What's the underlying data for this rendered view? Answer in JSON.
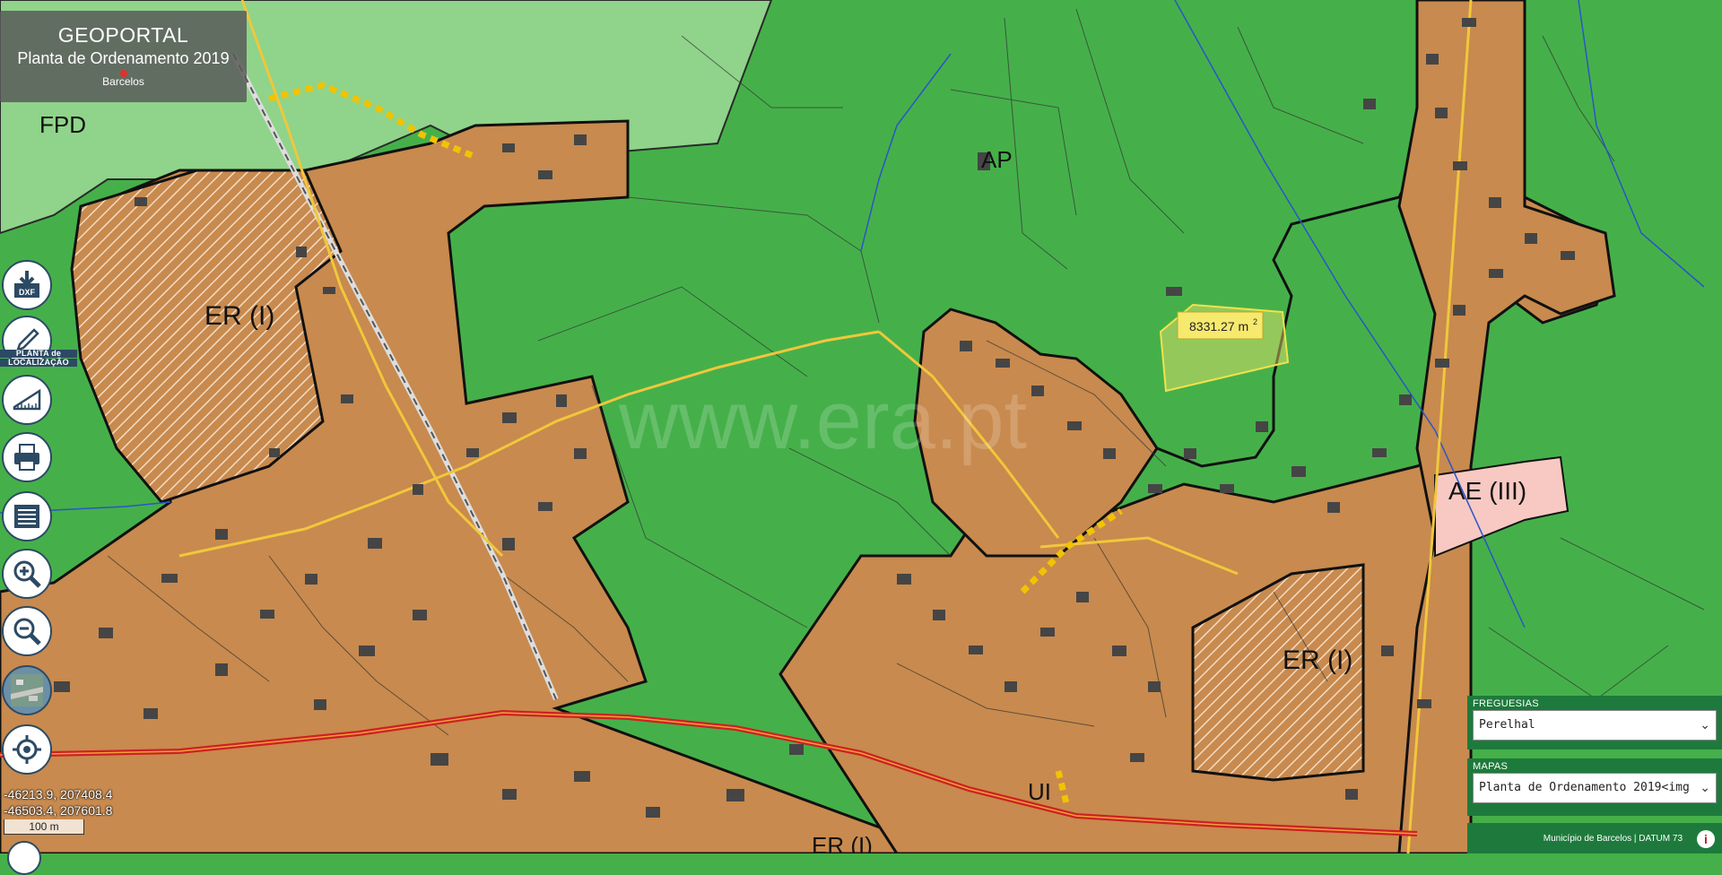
{
  "header": {
    "title": "GEOPORTAL",
    "subtitle": "Planta de Ordenamento 2019",
    "location": "Barcelos"
  },
  "zones": {
    "fpd": "FPD",
    "er1": "ER (I)",
    "er2": "ER (I)",
    "ap": "AP",
    "ae3": "AE (III)",
    "ul": "UI",
    "erb": "ER (I)"
  },
  "measurement": {
    "area": "8331.27 m",
    "unit_sup": "2"
  },
  "watermark": "www.era.pt",
  "toolbar": {
    "dxf_label": "DXF",
    "location_plan_label_1": "PLANTA de",
    "location_plan_label_2": "LOCALIZAÇÃO"
  },
  "coords": {
    "line1": "-46213.9, 207408.4",
    "line2": "-46503.4, 207601.8"
  },
  "scale": {
    "label": "100 m"
  },
  "freguesias": {
    "label": "FREGUESIAS",
    "selected": "Perelhal"
  },
  "mapas": {
    "label": "MAPAS",
    "selected": "Planta de Ordenamento 2019<img"
  },
  "footer": {
    "credit": "Município de Barcelos | DATUM 73"
  },
  "colors": {
    "urban": "#c88a4e",
    "forest": "#45b04a",
    "forest_light": "#8fd48a",
    "industrial": "#f7c9c2",
    "road": "#cc2222"
  }
}
